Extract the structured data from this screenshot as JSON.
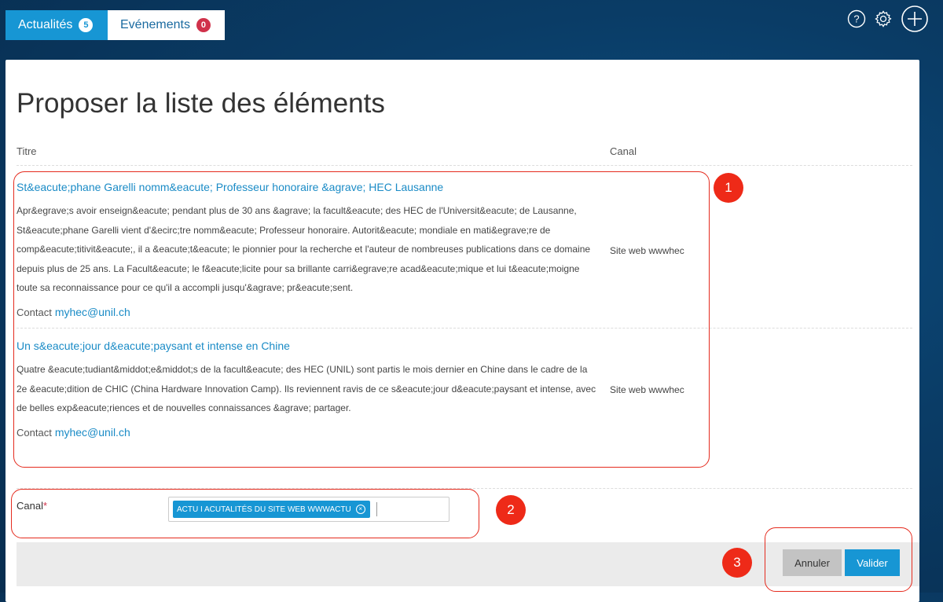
{
  "tabs": [
    {
      "label": "Actualités",
      "badge": "5"
    },
    {
      "label": "Evénements",
      "badge": "0"
    }
  ],
  "icons": {
    "help": "help-circle-icon",
    "settings": "gear-icon",
    "add": "plus-circle-icon"
  },
  "page": {
    "title": "Proposer la liste des éléments",
    "col_titre": "Titre",
    "col_canal": "Canal"
  },
  "items": [
    {
      "title": "St&eacute;phane Garelli nomm&eacute; Professeur honoraire &agrave; HEC Lausanne",
      "body": "Apr&egrave;s avoir enseign&eacute; pendant plus de 30 ans &agrave; la facult&eacute; des HEC de l'Universit&eacute; de Lausanne, St&eacute;phane Garelli vient d'&ecirc;tre nomm&eacute; Professeur honoraire. Autorit&eacute; mondiale en mati&egrave;re de comp&eacute;titivit&eacute;, il a &eacute;t&eacute; le pionnier pour la recherche et l'auteur de nombreuses publications dans ce domaine depuis plus de 25 ans. La Facult&eacute; le f&eacute;licite pour sa brillante carri&egrave;re acad&eacute;mique et lui t&eacute;moigne toute sa reconnaissance pour ce qu'il a accompli jusqu'&agrave; pr&eacute;sent.",
      "contact_label": "Contact",
      "contact_email": "myhec@unil.ch",
      "canal": "Site web wwwhec"
    },
    {
      "title": "Un s&eacute;jour d&eacute;paysant et intense en Chine",
      "body": "Quatre &eacute;tudiant&middot;e&middot;s de la facult&eacute; des HEC (UNIL) sont partis le mois dernier en Chine dans le cadre de la 2e &eacute;dition de CHIC (China Hardware Innovation Camp). Ils reviennent ravis de ce s&eacute;jour d&eacute;paysant et intense, avec de belles exp&eacute;riences et de nouvelles connaissances &agrave; partager.",
      "contact_label": "Contact",
      "contact_email": "myhec@unil.ch",
      "canal": "Site web wwwhec"
    }
  ],
  "form": {
    "canal_label": "Canal",
    "required_mark": "*",
    "selected_tag": "ACTU I ACUTALITÉS DU SITE WEB WWWACTU"
  },
  "buttons": {
    "cancel": "Annuler",
    "ok": "Valider"
  },
  "annotations": [
    "1",
    "2",
    "3"
  ],
  "colors": {
    "accent": "#1796d4",
    "annotation": "#ee2a18",
    "badge_red": "#d0314a"
  }
}
